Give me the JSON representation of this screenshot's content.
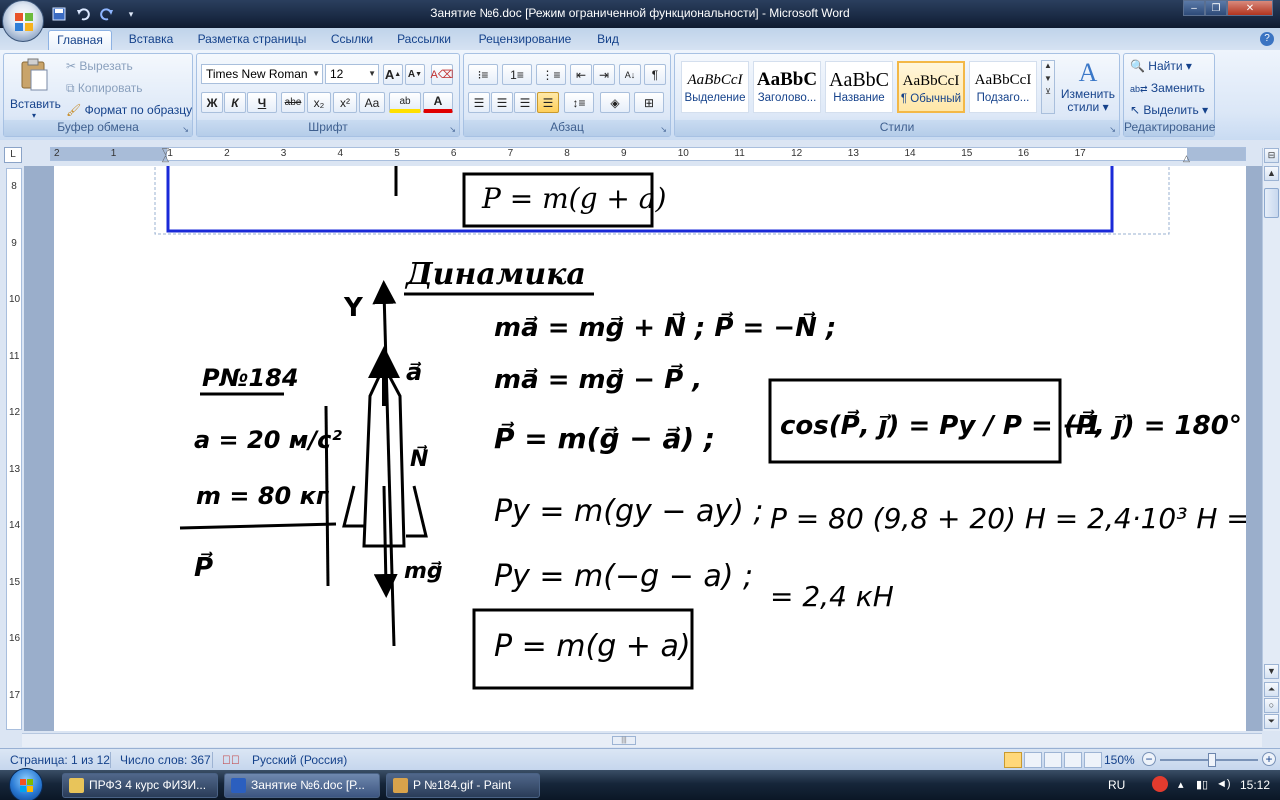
{
  "window": {
    "title": "Занятие №6.doc [Режим ограниченной функциональности] - Microsoft Word",
    "controls": {
      "minimize": "‒",
      "maximize": "❐",
      "close": "✕"
    }
  },
  "qat": {
    "save_icon": "save-icon",
    "undo_icon": "undo-icon",
    "redo_icon": "redo-icon"
  },
  "tabs": [
    "Главная",
    "Вставка",
    "Разметка страницы",
    "Ссылки",
    "Рассылки",
    "Рецензирование",
    "Вид"
  ],
  "active_tab": "Главная",
  "clipboard": {
    "title": "Буфер обмена",
    "paste": "Вставить",
    "cut": "Вырезать",
    "copy": "Копировать",
    "format_painter": "Формат по образцу"
  },
  "font": {
    "title": "Шрифт",
    "family": "Times New Roman",
    "size": "12",
    "grow": "A",
    "shrink": "A",
    "bold": "Ж",
    "italic": "К",
    "underline": "Ч",
    "strike": "abe",
    "subscript": "x₂",
    "superscript": "x²",
    "change_case": "Aa",
    "highlight": "ab",
    "font_color": "A"
  },
  "paragraph": {
    "title": "Абзац",
    "pilcrow": "¶"
  },
  "styles": {
    "title": "Стили",
    "items": [
      {
        "sample": "AaBbCcI",
        "name": "Выделение"
      },
      {
        "sample": "AaBbC",
        "name": "Заголово..."
      },
      {
        "sample": "AaBbC",
        "name": "Название"
      },
      {
        "sample": "AaBbCcI",
        "name": "¶ Обычный"
      },
      {
        "sample": "AaBbCcI",
        "name": "Подзаго..."
      }
    ],
    "selected_index": 3,
    "change_styles": "Изменить стили"
  },
  "editing": {
    "title": "Редактирование",
    "find": "Найти",
    "replace": "Заменить",
    "select": "Выделить"
  },
  "ruler": {
    "h_numbers": [
      "2",
      "1",
      "1",
      "2",
      "3",
      "4",
      "5",
      "6",
      "7",
      "8",
      "9",
      "10",
      "11",
      "12",
      "13",
      "14",
      "15",
      "16",
      "17"
    ],
    "v_numbers": [
      "8",
      "9",
      "10",
      "11",
      "12",
      "13",
      "14",
      "15",
      "16",
      "17"
    ],
    "tab_selector": "L"
  },
  "document": {
    "heading": "Динамика",
    "problem_label": "P№184",
    "given": [
      "a = 20 м/с²",
      "m = 80 кг"
    ],
    "find": "P⃗",
    "axis_label": "Y",
    "vec_a": "a⃗",
    "vec_N": "N⃗",
    "vec_mg": "mg⃗",
    "equations": [
      "ma⃗ = mg⃗ + N⃗ ;   P⃗ = −N⃗ ;",
      "ma⃗ = mg⃗ − P⃗ ,",
      "P⃗ = m(g⃗ − a⃗) ;",
      "Py = m(gy − ay) ;",
      "Py = m(−g − a) ;"
    ],
    "boxed_result": "P = m(g + a)",
    "top_boxed": "P = m(g + a)",
    "cos_box": "cos(P⃗, j⃗) = Py / P = −1",
    "angle": "(P⃗, j⃗) = 180°",
    "calc1": "P = 80 (9,8 + 20) Н = 2,4·10³ Н =",
    "calc2": "= 2,4 кН"
  },
  "status": {
    "page": "Страница: 1 из 12",
    "words": "Число слов: 367",
    "language": "Русский (Россия)",
    "zoom": "150%",
    "zoom_minus": "−",
    "zoom_plus": "+"
  },
  "taskbar": {
    "items": [
      {
        "label": "ПРФЗ 4 курс ФИЗИ...",
        "icon": "folder-icon"
      },
      {
        "label": "Занятие №6.doc [Р...",
        "icon": "word-icon"
      },
      {
        "label": "P №184.gif - Paint",
        "icon": "paint-icon"
      }
    ],
    "lang": "RU",
    "time": "15:12"
  }
}
